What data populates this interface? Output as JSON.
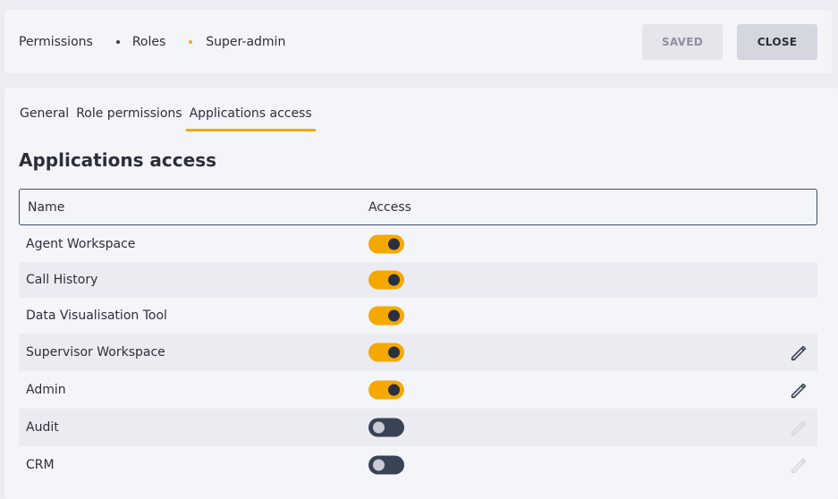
{
  "breadcrumb": [
    "Permissions",
    "Roles",
    "Super-admin"
  ],
  "buttons": {
    "saved": "SAVED",
    "close": "CLOSE"
  },
  "tabs": [
    {
      "label": "General",
      "active": false
    },
    {
      "label": "Role permissions",
      "active": false
    },
    {
      "label": "Applications access",
      "active": true
    }
  ],
  "section_title": "Applications access",
  "table": {
    "columns": [
      "Name",
      "Access"
    ],
    "rows": [
      {
        "name": "Agent Workspace",
        "access": true,
        "edit": "none"
      },
      {
        "name": "Call History",
        "access": true,
        "edit": "none"
      },
      {
        "name": "Data Visualisation Tool",
        "access": true,
        "edit": "none"
      },
      {
        "name": "Supervisor Workspace",
        "access": true,
        "edit": "enabled"
      },
      {
        "name": "Admin",
        "access": true,
        "edit": "enabled"
      },
      {
        "name": "Audit",
        "access": false,
        "edit": "disabled"
      },
      {
        "name": "CRM",
        "access": false,
        "edit": "disabled"
      }
    ]
  },
  "colors": {
    "accent": "#f5a800",
    "toggle_off": "#3a4256",
    "text": "#2b2f3a",
    "icon_enabled": "#3a4256",
    "icon_disabled": "#d4d7df"
  },
  "icons": {
    "edit": "pencil-icon"
  }
}
